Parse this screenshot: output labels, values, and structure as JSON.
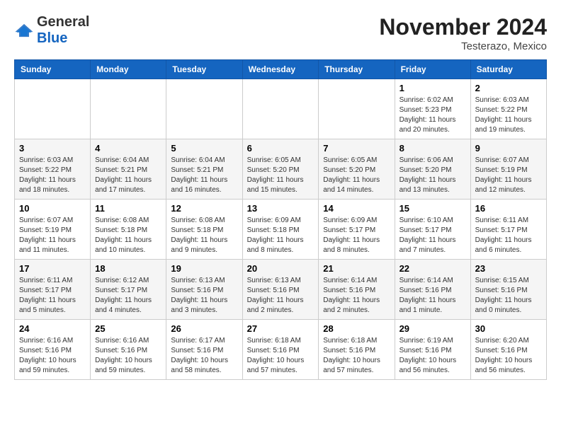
{
  "header": {
    "logo": {
      "general": "General",
      "blue": "Blue"
    },
    "title": "November 2024",
    "location": "Testerazo, Mexico"
  },
  "calendar": {
    "days": [
      "Sunday",
      "Monday",
      "Tuesday",
      "Wednesday",
      "Thursday",
      "Friday",
      "Saturday"
    ],
    "weeks": [
      [
        {
          "day": "",
          "info": ""
        },
        {
          "day": "",
          "info": ""
        },
        {
          "day": "",
          "info": ""
        },
        {
          "day": "",
          "info": ""
        },
        {
          "day": "",
          "info": ""
        },
        {
          "day": "1",
          "info": "Sunrise: 6:02 AM\nSunset: 5:23 PM\nDaylight: 11 hours and 20 minutes."
        },
        {
          "day": "2",
          "info": "Sunrise: 6:03 AM\nSunset: 5:22 PM\nDaylight: 11 hours and 19 minutes."
        }
      ],
      [
        {
          "day": "3",
          "info": "Sunrise: 6:03 AM\nSunset: 5:22 PM\nDaylight: 11 hours and 18 minutes."
        },
        {
          "day": "4",
          "info": "Sunrise: 6:04 AM\nSunset: 5:21 PM\nDaylight: 11 hours and 17 minutes."
        },
        {
          "day": "5",
          "info": "Sunrise: 6:04 AM\nSunset: 5:21 PM\nDaylight: 11 hours and 16 minutes."
        },
        {
          "day": "6",
          "info": "Sunrise: 6:05 AM\nSunset: 5:20 PM\nDaylight: 11 hours and 15 minutes."
        },
        {
          "day": "7",
          "info": "Sunrise: 6:05 AM\nSunset: 5:20 PM\nDaylight: 11 hours and 14 minutes."
        },
        {
          "day": "8",
          "info": "Sunrise: 6:06 AM\nSunset: 5:20 PM\nDaylight: 11 hours and 13 minutes."
        },
        {
          "day": "9",
          "info": "Sunrise: 6:07 AM\nSunset: 5:19 PM\nDaylight: 11 hours and 12 minutes."
        }
      ],
      [
        {
          "day": "10",
          "info": "Sunrise: 6:07 AM\nSunset: 5:19 PM\nDaylight: 11 hours and 11 minutes."
        },
        {
          "day": "11",
          "info": "Sunrise: 6:08 AM\nSunset: 5:18 PM\nDaylight: 11 hours and 10 minutes."
        },
        {
          "day": "12",
          "info": "Sunrise: 6:08 AM\nSunset: 5:18 PM\nDaylight: 11 hours and 9 minutes."
        },
        {
          "day": "13",
          "info": "Sunrise: 6:09 AM\nSunset: 5:18 PM\nDaylight: 11 hours and 8 minutes."
        },
        {
          "day": "14",
          "info": "Sunrise: 6:09 AM\nSunset: 5:17 PM\nDaylight: 11 hours and 8 minutes."
        },
        {
          "day": "15",
          "info": "Sunrise: 6:10 AM\nSunset: 5:17 PM\nDaylight: 11 hours and 7 minutes."
        },
        {
          "day": "16",
          "info": "Sunrise: 6:11 AM\nSunset: 5:17 PM\nDaylight: 11 hours and 6 minutes."
        }
      ],
      [
        {
          "day": "17",
          "info": "Sunrise: 6:11 AM\nSunset: 5:17 PM\nDaylight: 11 hours and 5 minutes."
        },
        {
          "day": "18",
          "info": "Sunrise: 6:12 AM\nSunset: 5:17 PM\nDaylight: 11 hours and 4 minutes."
        },
        {
          "day": "19",
          "info": "Sunrise: 6:13 AM\nSunset: 5:16 PM\nDaylight: 11 hours and 3 minutes."
        },
        {
          "day": "20",
          "info": "Sunrise: 6:13 AM\nSunset: 5:16 PM\nDaylight: 11 hours and 2 minutes."
        },
        {
          "day": "21",
          "info": "Sunrise: 6:14 AM\nSunset: 5:16 PM\nDaylight: 11 hours and 2 minutes."
        },
        {
          "day": "22",
          "info": "Sunrise: 6:14 AM\nSunset: 5:16 PM\nDaylight: 11 hours and 1 minute."
        },
        {
          "day": "23",
          "info": "Sunrise: 6:15 AM\nSunset: 5:16 PM\nDaylight: 11 hours and 0 minutes."
        }
      ],
      [
        {
          "day": "24",
          "info": "Sunrise: 6:16 AM\nSunset: 5:16 PM\nDaylight: 10 hours and 59 minutes."
        },
        {
          "day": "25",
          "info": "Sunrise: 6:16 AM\nSunset: 5:16 PM\nDaylight: 10 hours and 59 minutes."
        },
        {
          "day": "26",
          "info": "Sunrise: 6:17 AM\nSunset: 5:16 PM\nDaylight: 10 hours and 58 minutes."
        },
        {
          "day": "27",
          "info": "Sunrise: 6:18 AM\nSunset: 5:16 PM\nDaylight: 10 hours and 57 minutes."
        },
        {
          "day": "28",
          "info": "Sunrise: 6:18 AM\nSunset: 5:16 PM\nDaylight: 10 hours and 57 minutes."
        },
        {
          "day": "29",
          "info": "Sunrise: 6:19 AM\nSunset: 5:16 PM\nDaylight: 10 hours and 56 minutes."
        },
        {
          "day": "30",
          "info": "Sunrise: 6:20 AM\nSunset: 5:16 PM\nDaylight: 10 hours and 56 minutes."
        }
      ]
    ]
  }
}
